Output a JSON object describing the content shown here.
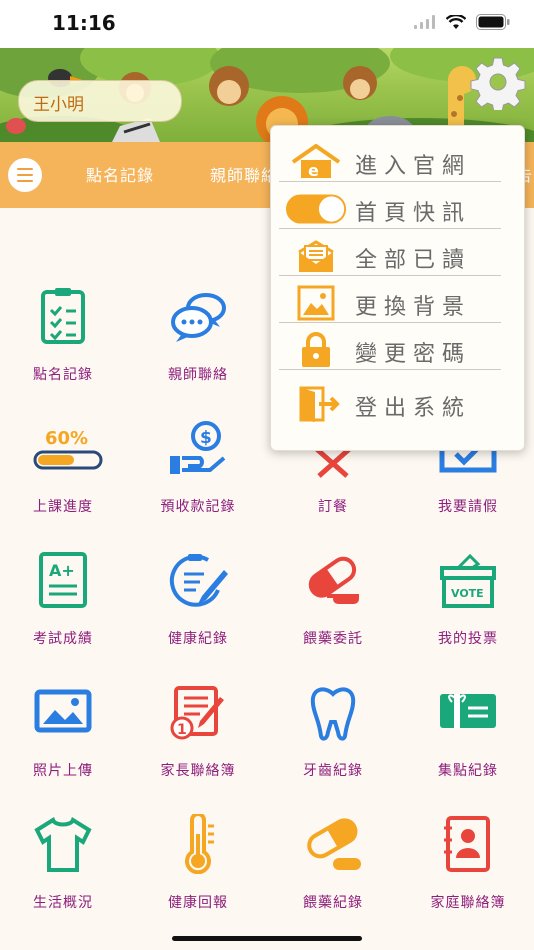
{
  "status_bar": {
    "time": "11:16"
  },
  "header": {
    "user_name": "王小明"
  },
  "navbar": {
    "items": [
      "點名記錄",
      "親師聯絡",
      "告"
    ]
  },
  "grid": {
    "items": [
      {
        "label": "點名記錄",
        "icon": "clipboard-check-icon"
      },
      {
        "label": "親師聯絡",
        "icon": "chat-bubbles-icon"
      },
      {
        "label": "",
        "icon": "hidden"
      },
      {
        "label": "",
        "icon": "hidden"
      },
      {
        "label": "上課進度",
        "icon": "progress-bar-icon",
        "progress_text": "60%",
        "progress": 0.6
      },
      {
        "label": "預收款記錄",
        "icon": "money-hand-icon"
      },
      {
        "label": "訂餐",
        "icon": "utensils-icon"
      },
      {
        "label": "我要請假",
        "icon": "calendar-check-icon"
      },
      {
        "label": "考試成績",
        "icon": "grade-sheet-icon",
        "grade_text": "A+"
      },
      {
        "label": "健康紀錄",
        "icon": "health-notepad-icon"
      },
      {
        "label": "餵藥委託",
        "icon": "pill-capsule-icon"
      },
      {
        "label": "我的投票",
        "icon": "ballot-box-icon",
        "vote_text": "VOTE"
      },
      {
        "label": "照片上傳",
        "icon": "photo-upload-icon"
      },
      {
        "label": "家長聯絡簿",
        "icon": "contact-book-pen-icon"
      },
      {
        "label": "牙齒紀錄",
        "icon": "tooth-icon"
      },
      {
        "label": "集點紀錄",
        "icon": "gift-card-icon"
      },
      {
        "label": "生活概況",
        "icon": "tshirt-icon"
      },
      {
        "label": "健康回報",
        "icon": "thermometer-icon"
      },
      {
        "label": "餵藥紀錄",
        "icon": "capsules-icon"
      },
      {
        "label": "家庭聯絡簿",
        "icon": "address-book-icon"
      }
    ]
  },
  "dropdown": {
    "items": [
      {
        "label": "進入官網",
        "icon": "home-e-icon"
      },
      {
        "label": "首頁快訊",
        "icon": "toggle-switch-icon",
        "toggle_on": true
      },
      {
        "label": "全部已讀",
        "icon": "mail-read-icon"
      },
      {
        "label": "更換背景",
        "icon": "picture-icon"
      },
      {
        "label": "變更密碼",
        "icon": "lock-icon"
      },
      {
        "label": "登出系統",
        "icon": "logout-door-icon"
      }
    ]
  },
  "colors": {
    "accent_orange": "#f5b45a",
    "label_purple": "#8e1f7e",
    "icon_green": "#1aa77a",
    "icon_blue": "#2a7de1",
    "icon_red": "#e8453c",
    "icon_orange": "#f5a623"
  }
}
